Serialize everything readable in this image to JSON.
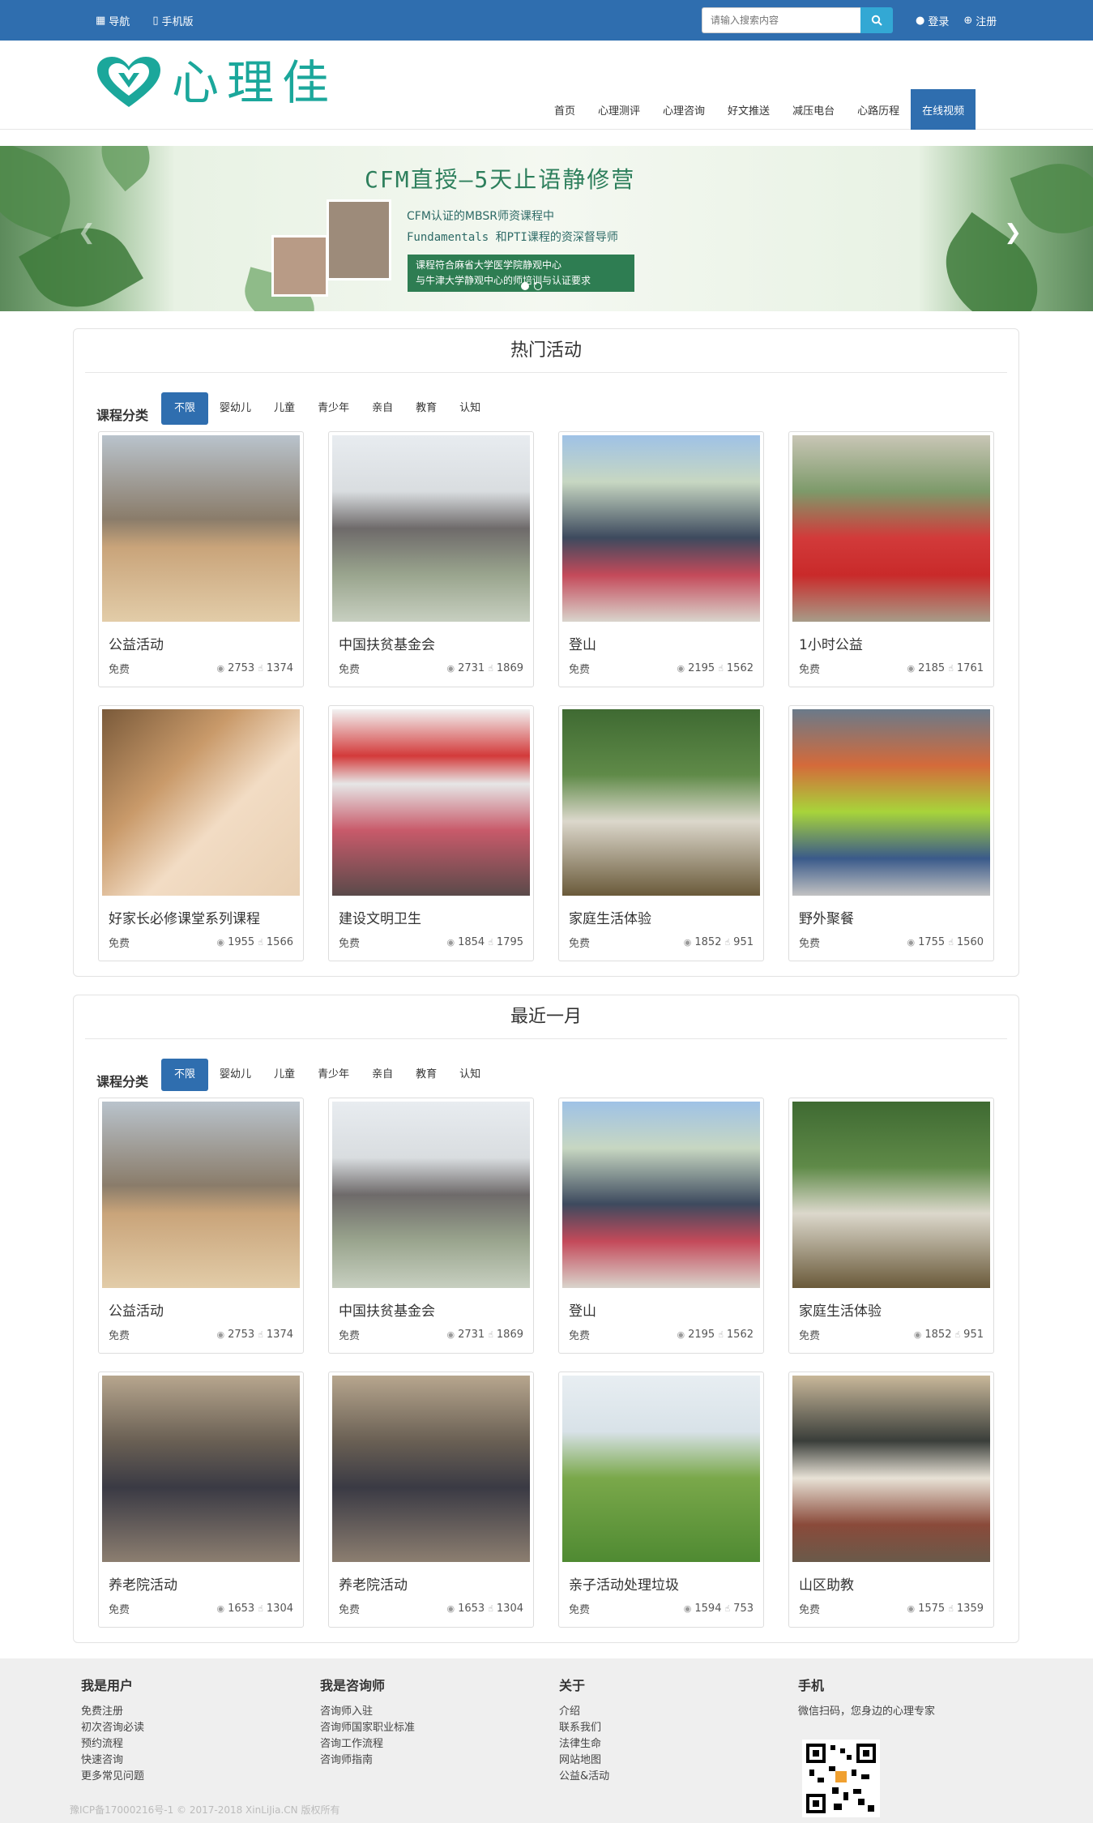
{
  "topbar": {
    "nav_label": "导航",
    "mobile_label": "手机版",
    "search_placeholder": "请输入搜索内容",
    "login": "登录",
    "register": "注册"
  },
  "logo": {
    "text": "心理佳"
  },
  "mainnav": [
    {
      "label": "首页"
    },
    {
      "label": "心理测评"
    },
    {
      "label": "心理咨询"
    },
    {
      "label": "好文推送"
    },
    {
      "label": "减压电台"
    },
    {
      "label": "心路历程"
    },
    {
      "label": "在线视频"
    }
  ],
  "banner": {
    "title": "CFM直授—5天止语静修营",
    "line1": "CFM认证的MBSR师资课程中",
    "line2": "Fundamentals 和PTI课程的资深督导师",
    "box1": "课程符合麻省大学医学院静观中心",
    "box2": "与牛津大学静观中心的师培训与认证要求"
  },
  "sections": [
    {
      "title": "热门活动",
      "cat_label": "课程分类",
      "tabs": [
        "不限",
        "婴幼儿",
        "儿童",
        "青少年",
        "亲自",
        "教育",
        "认知"
      ],
      "cards": [
        {
          "title": "公益活动",
          "price": "免费",
          "views": "2753",
          "likes": "1374"
        },
        {
          "title": "中国扶贫基金会",
          "price": "免费",
          "views": "2731",
          "likes": "1869"
        },
        {
          "title": "登山",
          "price": "免费",
          "views": "2195",
          "likes": "1562"
        },
        {
          "title": "1小时公益",
          "price": "免费",
          "views": "2185",
          "likes": "1761"
        },
        {
          "title": "好家长必修课堂系列课程",
          "price": "免费",
          "views": "1955",
          "likes": "1566"
        },
        {
          "title": "建设文明卫生",
          "price": "免费",
          "views": "1854",
          "likes": "1795"
        },
        {
          "title": "家庭生活体验",
          "price": "免费",
          "views": "1852",
          "likes": "951"
        },
        {
          "title": "野外聚餐",
          "price": "免费",
          "views": "1755",
          "likes": "1560"
        }
      ]
    },
    {
      "title": "最近一月",
      "cat_label": "课程分类",
      "tabs": [
        "不限",
        "婴幼儿",
        "儿童",
        "青少年",
        "亲自",
        "教育",
        "认知"
      ],
      "cards": [
        {
          "title": "公益活动",
          "price": "免费",
          "views": "2753",
          "likes": "1374"
        },
        {
          "title": "中国扶贫基金会",
          "price": "免费",
          "views": "2731",
          "likes": "1869"
        },
        {
          "title": "登山",
          "price": "免费",
          "views": "2195",
          "likes": "1562"
        },
        {
          "title": "家庭生活体验",
          "price": "免费",
          "views": "1852",
          "likes": "951"
        },
        {
          "title": "养老院活动",
          "price": "免费",
          "views": "1653",
          "likes": "1304"
        },
        {
          "title": "养老院活动",
          "price": "免费",
          "views": "1653",
          "likes": "1304"
        },
        {
          "title": "亲子活动处理垃圾",
          "price": "免费",
          "views": "1594",
          "likes": "753"
        },
        {
          "title": "山区助教",
          "price": "免费",
          "views": "1575",
          "likes": "1359"
        }
      ]
    }
  ],
  "footer": {
    "cols": [
      {
        "head": "我是用户",
        "links": [
          "免费注册",
          "初次咨询必读",
          "预约流程",
          "快速咨询",
          "更多常见问题"
        ]
      },
      {
        "head": "我是咨询师",
        "links": [
          "咨询师入驻",
          "咨询师国家职业标准",
          "咨询工作流程",
          "咨询师指南"
        ]
      },
      {
        "head": "关于",
        "links": [
          "介绍",
          "联系我们",
          "法律生命",
          "网站地图",
          "公益&活动"
        ]
      },
      {
        "head": "手机",
        "links": [
          "微信扫码，您身边的心理专家"
        ]
      }
    ],
    "copyright": "豫ICP备17000216号-1 © 2017-2018 XinLiJia.CN 版权所有"
  },
  "colors": {
    "primary": "#2f6eaf",
    "brand": "#1ba79b",
    "search_btn": "#33a8d4"
  }
}
